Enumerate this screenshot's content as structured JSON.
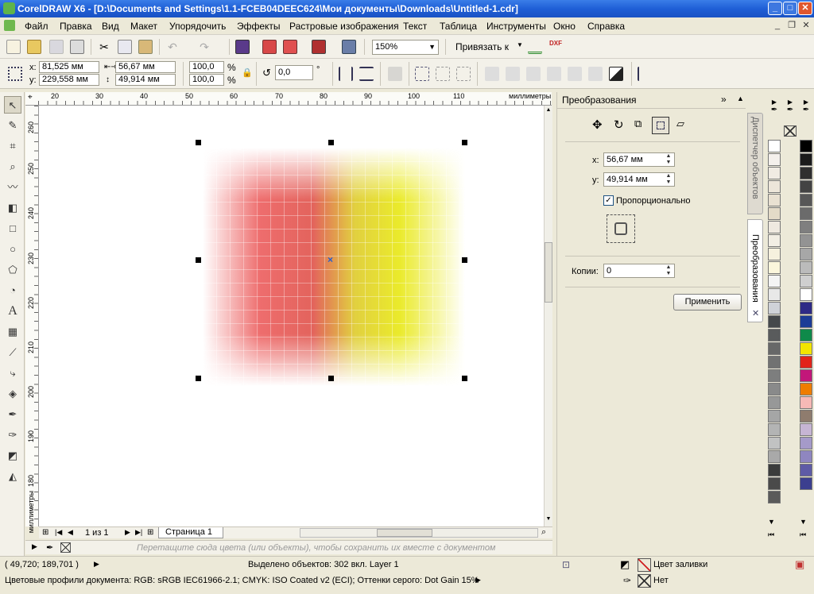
{
  "window": {
    "title": "CorelDRAW X6 - [D:\\Documents and Settings\\1.1-FCEB04DEEC624\\Мои документы\\Downloads\\Untitled-1.cdr]",
    "min": "_",
    "max": "□",
    "close": "✕"
  },
  "menu": {
    "items": [
      "Файл",
      "Правка",
      "Вид",
      "Макет",
      "Упорядочить",
      "Эффекты",
      "Растровые изображения",
      "Текст",
      "Таблица",
      "Инструменты",
      "Окно",
      "Справка"
    ]
  },
  "toolbar": {
    "zoom": "150%",
    "snap_label": "Привязать к",
    "dxf": "DXF"
  },
  "props": {
    "x_label": "x:",
    "y_label": "y:",
    "x": "81,525 мм",
    "y": "229,558 мм",
    "w": "56,67 мм",
    "h": "49,914 мм",
    "sx": "100,0",
    "sy": "100,0",
    "pct": "%",
    "angle": "0,0",
    "deg": "°"
  },
  "ruler": {
    "units": "миллиметры",
    "h_ticks": [
      "20",
      "30",
      "40",
      "50",
      "60",
      "70",
      "80",
      "90",
      "100",
      "110"
    ],
    "v_ticks": [
      "260",
      "250",
      "240",
      "230",
      "220",
      "210",
      "200",
      "190",
      "180"
    ],
    "v_units": "миллиметры"
  },
  "nav": {
    "page_of": "1 из 1",
    "page_tab": "Страница 1"
  },
  "palette_hint": "Перетащите сюда цвета (или объекты), чтобы сохранить их вместе с документом",
  "docker": {
    "title": "Преобразования",
    "x_label": "x:",
    "y_label": "y:",
    "x_value": "56,67 мм",
    "y_value": "49,914 мм",
    "proportional": "Пропорционально",
    "copies_label": "Копии:",
    "copies_value": "0",
    "apply": "Применить",
    "tab1": "Диспетчер объектов",
    "tab2": "Преобразования"
  },
  "status": {
    "coords": "( 49,720; 189,701 )",
    "selection": "Выделено объектов: 302 вкл. Layer 1",
    "fill_label": "Цвет заливки",
    "outline_label": "Нет",
    "profiles": "Цветовые профили документа: RGB: sRGB IEC61966-2.1; CMYK: ISO Coated v2 (ECI); Оттенки серого: Dot Gain 15%"
  },
  "colors": {
    "palette1": [
      "#ffffff",
      "#f4f0ec",
      "#f0ebe3",
      "#ede6da",
      "#e9e1d2",
      "#e4dbc8",
      "#efe9e0",
      "#f2eee4",
      "#f6f1de",
      "#fbf6dc",
      "#f4f4f4",
      "#e8e8e8",
      "#cfd2d8",
      "#45484b",
      "#595b5c",
      "#676868",
      "#717272",
      "#7d7e7e",
      "#898a8a",
      "#979898",
      "#a5a6a6",
      "#b3b4b4",
      "#c1c2c2",
      "#a9a9a9",
      "#3b3c3c",
      "#4a4a4a",
      "#5a5a5a"
    ],
    "palette2": [
      "#000000",
      "#1b1b1b",
      "#2f2f2f",
      "#434343",
      "#575757",
      "#6b6b6b",
      "#7f7f7f",
      "#939393",
      "#a7a7a7",
      "#bbbbbb",
      "#cfcfcf",
      "#ffffff",
      "#2e2a86",
      "#1c3c96",
      "#0f8a4a",
      "#f3e500",
      "#e2231a",
      "#c2177a",
      "#ee7d00",
      "#f7b9b6",
      "#8f7c6e",
      "#c6b5d4",
      "#a59ac9",
      "#8f86c0",
      "#5e5ba6",
      "#3c3f8f"
    ]
  }
}
